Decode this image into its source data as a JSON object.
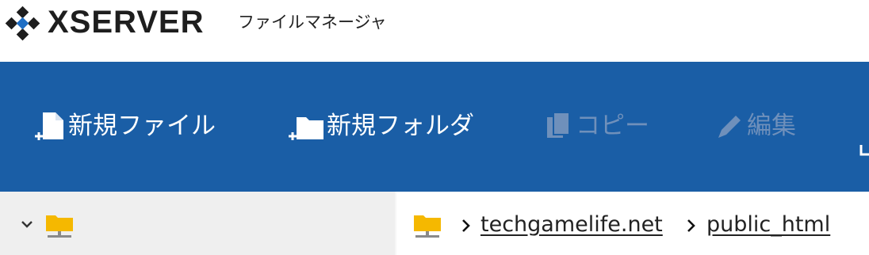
{
  "header": {
    "brand": "XSERVER",
    "app_title": "ファイルマネージャ"
  },
  "toolbar": {
    "new_file_label": "新規ファイル",
    "new_folder_label": "新規フォルダ",
    "copy_label": "コピー",
    "edit_label": "編集"
  },
  "tree": {
    "toggle_icon": "chevron-down-icon",
    "root_icon": "network-folder-icon"
  },
  "breadcrumb": {
    "root_icon": "network-folder-icon",
    "items": [
      "techgamelife.net",
      "public_html"
    ]
  },
  "colors": {
    "toolbar_bg": "#1a5ea6",
    "disabled_text": "#6f90bb",
    "folder": "#f5b800",
    "tree_bg": "#efefef"
  }
}
